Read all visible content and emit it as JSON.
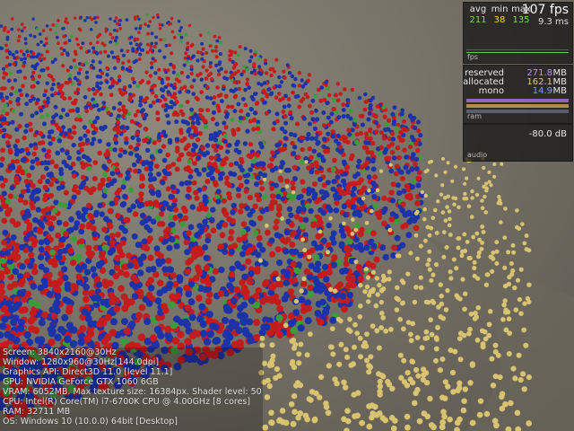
{
  "stats": {
    "fps": {
      "header_avg": "avg",
      "header_min": "min",
      "header_max": "max",
      "avg": "211",
      "min": "38",
      "max": "135",
      "fps_value": "107 fps",
      "frame_ms": "9.3 ms",
      "graph_label": "fps",
      "colors": {
        "avg": "#7ed957",
        "min": "#ffd23f",
        "max": "#7ed957"
      }
    },
    "memory": {
      "reserved_label": "reserved",
      "reserved_value": "271.8",
      "allocated_label": "allocated",
      "allocated_value": "162.1",
      "mono_label": "mono",
      "mono_value": "14.9",
      "unit": "MB",
      "graph_label": "ram",
      "colors": {
        "reserved": "#c98be8",
        "allocated": "#e7c37a",
        "mono": "#7f9bff"
      }
    },
    "audio": {
      "value": "-80.0 dB",
      "graph_label": "audio"
    }
  },
  "system_info": {
    "lines": [
      "Screen: 3840x2160@30Hz",
      "Window: 1280x960@30Hz[144.0dpi]",
      "Graphics API: Direct3D 11.0 [level 11.1]",
      "GPU: NVIDIA GeForce GTX 1060 6GB",
      "VRAM: 6052MB. Max texture size: 16384px. Shader level: 50",
      "CPU: Intel(R) Core(TM) i7-6700K CPU @ 4.00GHz [8 cores]",
      "RAM: 32711 MB",
      "OS: Windows 10  (10.0.0) 64bit [Desktop]"
    ]
  },
  "scene": {
    "object_colors": {
      "red": "#c41c1c",
      "blue": "#1c32a8",
      "green": "#3c9c3c",
      "yellow": "#d9c270"
    }
  }
}
